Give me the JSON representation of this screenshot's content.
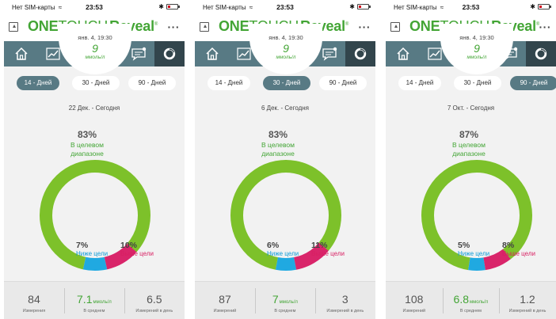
{
  "panels": [
    {
      "status": {
        "carrier": "Нет SIM-карты",
        "time": "23:53"
      },
      "header": {
        "logo_one": "ONE",
        "logo_touch": "TOUCH",
        "logo_reveal": "Reveal"
      },
      "bubble": {
        "datetime": "янв. 4, 19:30",
        "value": "9",
        "unit": "ммоль/л"
      },
      "tabs": [
        {
          "label": "14 - Дней",
          "active": true
        },
        {
          "label": "30 - Дней",
          "active": false
        },
        {
          "label": "90 - Дней",
          "active": false
        }
      ],
      "range_text": "22 Дек. - Сегодня",
      "in_range": {
        "percent": "83%",
        "label_line1": "В целевом",
        "label_line2": "диапазоне"
      },
      "below": {
        "percent": "7%",
        "label": "Ниже цели"
      },
      "above": {
        "percent": "10%",
        "label": "Выше цели"
      },
      "donut": {
        "in_range": 83,
        "below": 7,
        "above": 10
      },
      "stats": {
        "count": "84",
        "count_label": "Измерения",
        "avg": "7.1",
        "avg_unit": "ммоль/л",
        "avg_label": "В среднем",
        "perday": "6.5",
        "perday_label": "Измерений в день"
      }
    },
    {
      "status": {
        "carrier": "Нет SIM-карты",
        "time": "23:53"
      },
      "header": {
        "logo_one": "ONE",
        "logo_touch": "TOUCH",
        "logo_reveal": "Reveal"
      },
      "bubble": {
        "datetime": "янв. 4, 19:30",
        "value": "9",
        "unit": "ммоль/л"
      },
      "tabs": [
        {
          "label": "14 - Дней",
          "active": false
        },
        {
          "label": "30 - Дней",
          "active": true
        },
        {
          "label": "90 - Дней",
          "active": false
        }
      ],
      "range_text": "6 Дек. - Сегодня",
      "in_range": {
        "percent": "83%",
        "label_line1": "В целевом",
        "label_line2": "диапазоне"
      },
      "below": {
        "percent": "6%",
        "label": "Ниже цели"
      },
      "above": {
        "percent": "11%",
        "label": "Выше цели"
      },
      "donut": {
        "in_range": 83,
        "below": 6,
        "above": 11
      },
      "stats": {
        "count": "87",
        "count_label": "Измерений",
        "avg": "7",
        "avg_unit": "ммоль/л",
        "avg_label": "В среднем",
        "perday": "3",
        "perday_label": "Измерений в день"
      }
    },
    {
      "status": {
        "carrier": "Нет SIM-карты",
        "time": "23:53"
      },
      "header": {
        "logo_one": "ONE",
        "logo_touch": "TOUCH",
        "logo_reveal": "Reveal"
      },
      "bubble": {
        "datetime": "янв. 4, 19:30",
        "value": "9",
        "unit": "ммоль/л"
      },
      "tabs": [
        {
          "label": "14 - Дней",
          "active": false
        },
        {
          "label": "30 - Дней",
          "active": false
        },
        {
          "label": "90 - Дней",
          "active": true
        }
      ],
      "range_text": "7 Окт. - Сегодня",
      "in_range": {
        "percent": "87%",
        "label_line1": "В целевом",
        "label_line2": "диапазоне"
      },
      "below": {
        "percent": "5%",
        "label": "Ниже цели"
      },
      "above": {
        "percent": "8%",
        "label": "Выше цели"
      },
      "donut": {
        "in_range": 87,
        "below": 5,
        "above": 8
      },
      "stats": {
        "count": "108",
        "count_label": "Измерений",
        "avg": "6.8",
        "avg_unit": "ммоль/л",
        "avg_label": "В среднем",
        "perday": "1.2",
        "perday_label": "Измерений в день"
      }
    }
  ],
  "colors": {
    "in_range": "#7dc12a",
    "below": "#20a9e1",
    "above": "#d9256a",
    "nav": "#587a84",
    "nav_active": "#32454c"
  },
  "icons": [
    "share-icon",
    "home-icon",
    "trend-chart-icon",
    "message-icon",
    "donut-icon",
    "more-icon",
    "wifi-icon",
    "bluetooth-icon",
    "battery-icon"
  ]
}
